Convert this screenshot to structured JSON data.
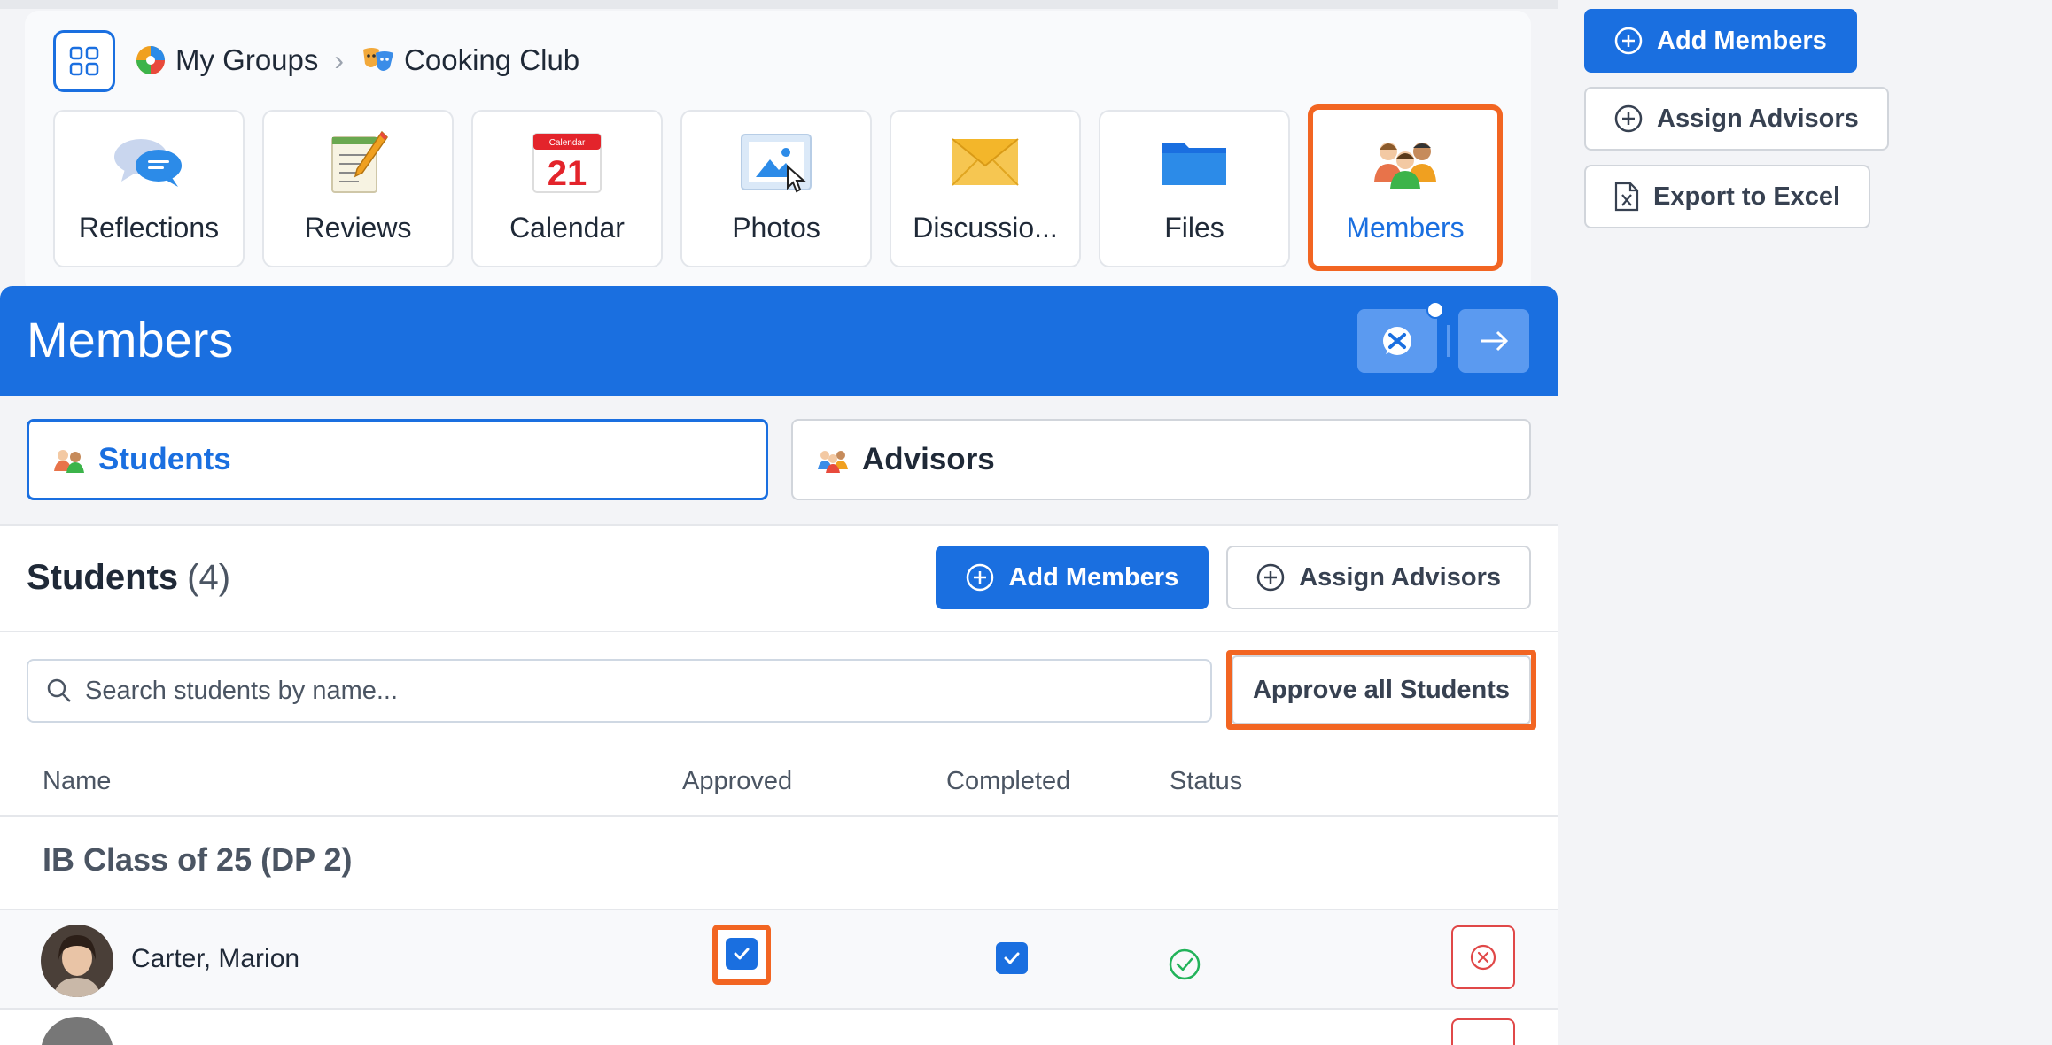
{
  "breadcrumb": {
    "root": "My Groups",
    "current": "Cooking Club"
  },
  "tiles": [
    {
      "label": "Reflections",
      "icon": "speech-bubbles-icon"
    },
    {
      "label": "Reviews",
      "icon": "notepad-pencil-icon"
    },
    {
      "label": "Calendar",
      "icon": "calendar-icon",
      "calendar_header": "Calendar",
      "calendar_day": "21"
    },
    {
      "label": "Photos",
      "icon": "photo-icon"
    },
    {
      "label": "Discussio...",
      "icon": "envelope-icon"
    },
    {
      "label": "Files",
      "icon": "folder-icon"
    },
    {
      "label": "Members",
      "icon": "people-group-icon"
    }
  ],
  "right_actions": {
    "add_members": "Add Members",
    "assign_advisors": "Assign Advisors",
    "export_excel": "Export to Excel"
  },
  "panel": {
    "title": "Members"
  },
  "tabs": {
    "students": "Students",
    "advisors": "Advisors"
  },
  "students_section": {
    "title": "Students",
    "count": "(4)",
    "add_members": "Add Members",
    "assign_advisors": "Assign Advisors"
  },
  "search": {
    "placeholder": "Search students by name...",
    "approve_all": "Approve all Students"
  },
  "table": {
    "headers": {
      "name": "Name",
      "approved": "Approved",
      "completed": "Completed",
      "status": "Status"
    },
    "group_label": "IB Class of 25 (DP 2)",
    "rows": [
      {
        "name": "Carter, Marion",
        "approved": true,
        "completed": true,
        "status": "ok"
      }
    ]
  },
  "colors": {
    "primary": "#1a6fe0",
    "highlight": "#f26522",
    "danger": "#e04848",
    "success": "#22b35a"
  }
}
